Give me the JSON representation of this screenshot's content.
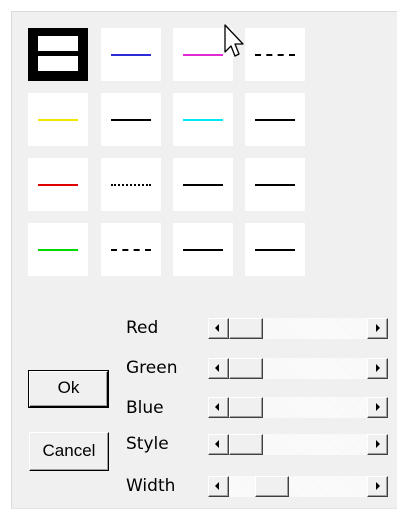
{
  "swatches": [
    {
      "style": "selected",
      "color": "#000000"
    },
    {
      "style": "solid",
      "color": "#2b2bd9"
    },
    {
      "style": "solid",
      "color": "#e12ad3"
    },
    {
      "style": "dashed",
      "color": "#000000"
    },
    {
      "style": "solid",
      "color": "#f0e800"
    },
    {
      "style": "solid",
      "color": "#000000"
    },
    {
      "style": "solid",
      "color": "#00e8f0"
    },
    {
      "style": "solid",
      "color": "#000000"
    },
    {
      "style": "solid",
      "color": "#e00000"
    },
    {
      "style": "dotted",
      "color": "#000000"
    },
    {
      "style": "solid",
      "color": "#000000"
    },
    {
      "style": "solid",
      "color": "#000000"
    },
    {
      "style": "solid",
      "color": "#00d800"
    },
    {
      "style": "dashdot",
      "color": "#000000"
    },
    {
      "style": "solid",
      "color": "#000000"
    },
    {
      "style": "solid",
      "color": "#000000"
    }
  ],
  "sliders": [
    {
      "label": "Red",
      "value": 0.0
    },
    {
      "label": "Green",
      "value": 0.0
    },
    {
      "label": "Blue",
      "value": 0.0
    },
    {
      "label": "Style",
      "value": 0.0
    },
    {
      "label": "Width",
      "value": 0.25
    }
  ],
  "buttons": {
    "ok": "Ok",
    "cancel": "Cancel"
  }
}
